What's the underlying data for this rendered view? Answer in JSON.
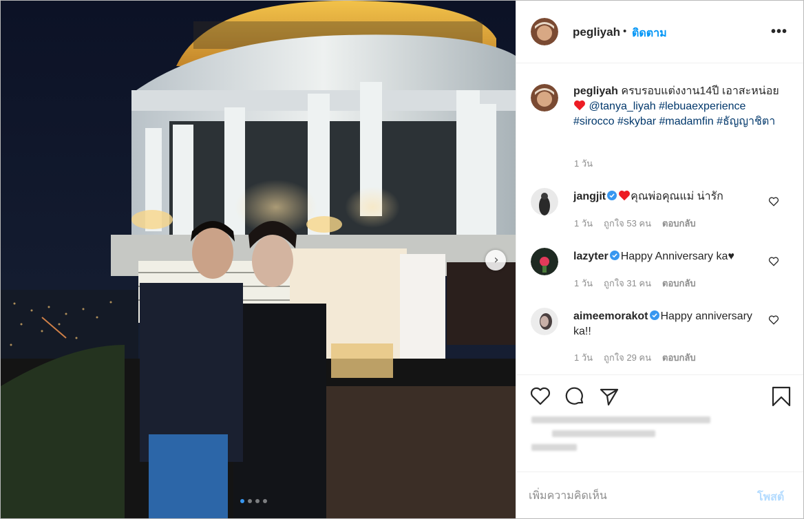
{
  "post": {
    "username": "pegliyah",
    "follow_dot": "•",
    "follow_label": "ติดตาม",
    "more_icon": "ellipsis-icon"
  },
  "caption": {
    "username": "pegliyah",
    "text": "ครบรอบแต่งงาน14ปี เอาสะหน่อย",
    "mention": "@tanya_liyah",
    "hashtags": "#lebuaexperience #sirocco #skybar #madamfin #ธัญญาชิตา",
    "time": "1 วัน"
  },
  "comments": [
    {
      "username": "jangjit",
      "text": "คุณพ่อคุณแม่ น่ารัก",
      "time": "1 วัน",
      "likes": "ถูกใจ 53 คน",
      "reply": "ตอบกลับ"
    },
    {
      "username": "lazyter",
      "text": "Happy Anniversary ka♥",
      "time": "1 วัน",
      "likes": "ถูกใจ 31 คน",
      "reply": "ตอบกลับ"
    },
    {
      "username": "aimeemorakot",
      "text": "Happy anniversary ka!!",
      "time": "1 วัน",
      "likes": "ถูกใจ 29 คน",
      "reply": "ตอบกลับ"
    }
  ],
  "add_comment": {
    "placeholder": "เพิ่มความคิดเห็น",
    "post_label": "โพสต์"
  },
  "carousel": {
    "slides": 4,
    "active_index": 0
  },
  "colors": {
    "link": "#00376b",
    "follow": "#0095f6",
    "verified": "#3897f0",
    "heart": "#ed4956"
  }
}
